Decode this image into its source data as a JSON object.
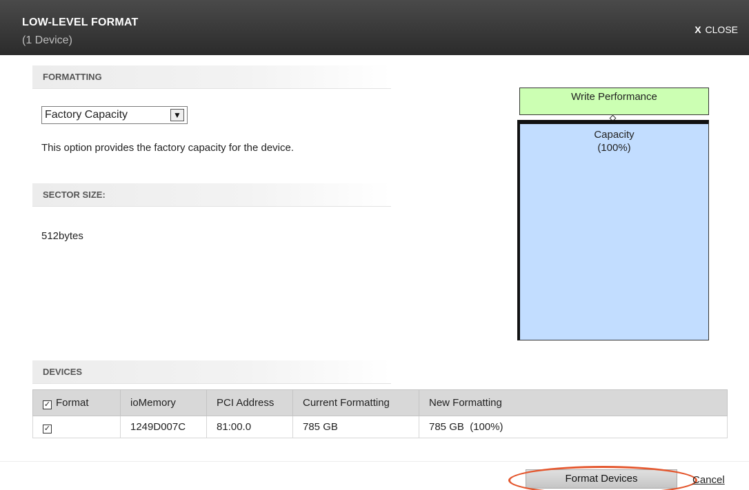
{
  "dialog": {
    "title": "LOW-LEVEL FORMAT",
    "subtitle": "(1 Device)",
    "close_x": "X",
    "close_label": "CLOSE"
  },
  "formatting": {
    "header": "FORMATTING",
    "select_value": "Factory Capacity",
    "description": "This option provides the factory capacity for the device."
  },
  "sector": {
    "header": "SECTOR SIZE:",
    "value": "512bytes"
  },
  "diagram": {
    "write_label": "Write Performance",
    "capacity_label": "Capacity",
    "capacity_percent": "(100%)",
    "write_color": "#ccffb3",
    "capacity_color": "#c2ddff"
  },
  "devices": {
    "header": "DEVICES",
    "columns": [
      "Format",
      "ioMemory",
      "PCI Address",
      "Current Formatting",
      "New Formatting"
    ],
    "rows": [
      {
        "checked": true,
        "iomemory": "1249D007C",
        "pci_address": "81:00.0",
        "current_formatting": "785 GB",
        "new_formatting": "785 GB  (100%)"
      }
    ]
  },
  "footer": {
    "format_button": "Format Devices",
    "cancel_link": "Cancel",
    "highlight_color": "#e4572e"
  }
}
